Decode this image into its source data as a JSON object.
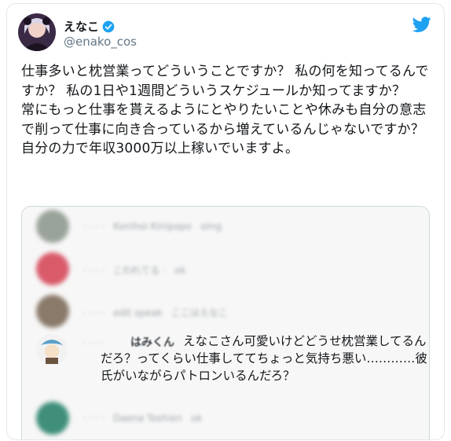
{
  "tweet": {
    "display_name": "えなこ",
    "handle": "@enako_cos",
    "verified": true,
    "lines": [
      "仕事多いと枕営業ってどういうことですか？ 私の何を知ってるんですか？ 私の1日や1週間どういうスケジュールか知ってますか？",
      "常にもっと仕事を貰えるようにとやりたいことや休みも自分の意志で削って仕事に向き合っているから増えているんじゃないですか？",
      "自分の力で年収3000万以上稼いでいますよ。"
    ]
  },
  "embedded": {
    "replies": [
      {
        "meta": "·  ·  · ·",
        "name": "Konihoi Kinipopo",
        "extra": "omg"
      },
      {
        "meta": "·  ·  · ·",
        "name": "こわれてる ·",
        "extra": "ok"
      },
      {
        "meta": "·  ·  · ·",
        "name": "edit speak",
        "extra": "ここはえなこ"
      },
      {
        "meta": "·  ·  · ·",
        "name": "はみくん",
        "text": "えなこさん可愛いけどどうせ枕営業してるんだろ？ってくらい仕事しててちょっと気持ち悪い…………彼氏がいながらパトロンいるんだろ？"
      },
      {
        "meta": "·  ·  · ·",
        "name": "Daena Toshien",
        "extra": "ok"
      }
    ]
  },
  "colors": {
    "twitter_blue": "#1da1f2",
    "text": "#14171a",
    "muted": "#657786"
  },
  "icons": [
    "twitter-bird-icon",
    "verified-badge-icon"
  ]
}
